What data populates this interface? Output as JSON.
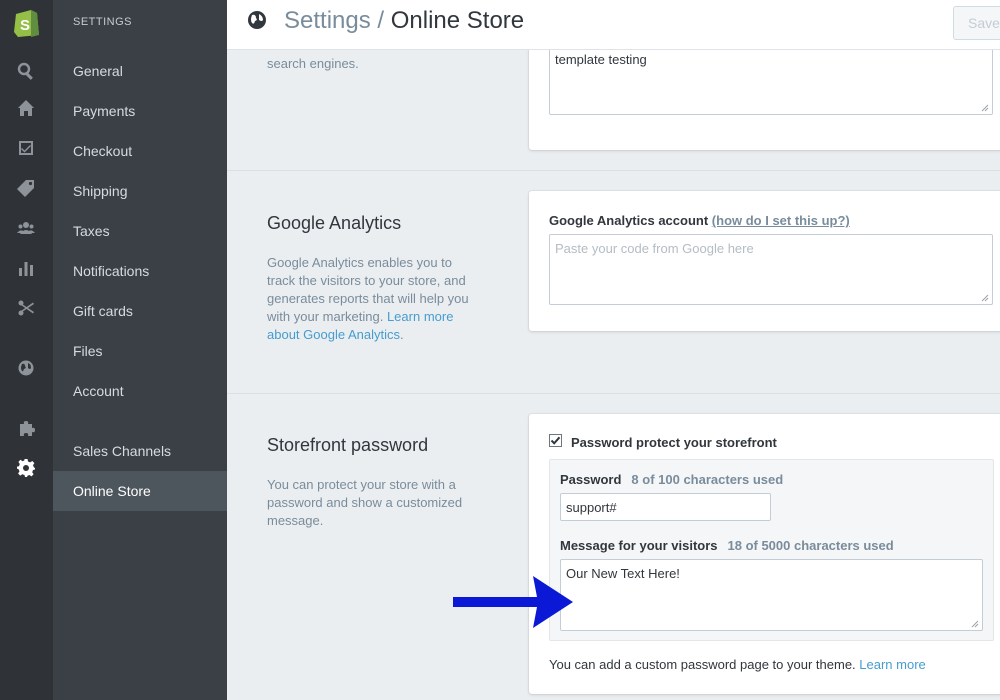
{
  "rail": {
    "icons": [
      "shopify-logo",
      "search-icon",
      "home-icon",
      "orders-icon",
      "tag-icon",
      "customers-icon",
      "reports-icon",
      "discounts-icon",
      "globe-icon",
      "apps-icon",
      "gear-icon"
    ]
  },
  "sidebar": {
    "heading": "SETTINGS",
    "items": [
      {
        "label": "General"
      },
      {
        "label": "Payments"
      },
      {
        "label": "Checkout"
      },
      {
        "label": "Shipping"
      },
      {
        "label": "Taxes"
      },
      {
        "label": "Notifications"
      },
      {
        "label": "Gift cards"
      },
      {
        "label": "Files"
      },
      {
        "label": "Account"
      },
      {
        "label": "Sales Channels"
      },
      {
        "label": "Online Store"
      }
    ],
    "active": "Online Store"
  },
  "header": {
    "crumb": "Settings",
    "separator": "/",
    "title": "Online Store",
    "save_label": "Save"
  },
  "seo": {
    "desc": "search engines.",
    "textarea_value": "template testing"
  },
  "analytics": {
    "title": "Google Analytics",
    "desc": "Google Analytics enables you to track the visitors to your store, and generates reports that will help you with your marketing.",
    "learn_more": "Learn more about Google Analytics",
    "field_label": "Google Analytics account",
    "help_link": "(how do I set this up?)",
    "placeholder": "Paste your code from Google here"
  },
  "storefront": {
    "title": "Storefront password",
    "desc": "You can protect your store with a password and show a customized message.",
    "checkbox_label": "Password protect your storefront",
    "checkbox_checked": true,
    "password_label": "Password",
    "password_counter": "8 of 100 characters used",
    "password_value": "support#",
    "message_label": "Message for your visitors",
    "message_counter": "18 of 5000 characters used",
    "message_value": "Our New Text Here!",
    "footer_text": "You can add a custom password page to your theme.",
    "footer_link": "Learn more"
  },
  "colors": {
    "accent": "#479ccf",
    "arrow": "#0b18d6",
    "rail_bg": "#2f3337",
    "sidebar_bg": "#3a4046"
  }
}
